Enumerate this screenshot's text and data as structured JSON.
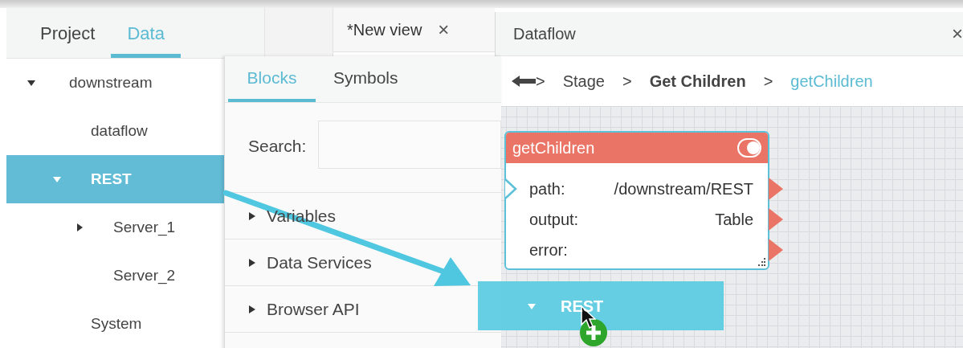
{
  "left_panel": {
    "tabs": [
      {
        "label": "Project",
        "selected": false
      },
      {
        "label": "Data",
        "selected": true
      }
    ],
    "tree": [
      {
        "label": "downstream",
        "kind": "branch",
        "expanded": true,
        "selected": false,
        "children": [
          {
            "label": "dataflow",
            "kind": "leaf",
            "selected": false
          },
          {
            "label": "REST",
            "kind": "branch",
            "expanded": true,
            "selected": true,
            "children": [
              {
                "label": "Server_1",
                "kind": "branch",
                "expanded": false,
                "selected": false
              },
              {
                "label": "Server_2",
                "kind": "leaf",
                "selected": false
              }
            ]
          },
          {
            "label": "System",
            "kind": "leaf",
            "selected": false
          }
        ]
      }
    ]
  },
  "editor_tab": {
    "label": "*New view",
    "close": "×"
  },
  "blocks_panel": {
    "tabs": [
      {
        "label": "Blocks",
        "selected": true
      },
      {
        "label": "Symbols",
        "selected": false
      }
    ],
    "search": {
      "label": "Search:"
    },
    "categories": [
      {
        "label": "Variables"
      },
      {
        "label": "Data Services"
      },
      {
        "label": "Browser API"
      }
    ]
  },
  "dataflow": {
    "title": "Dataflow",
    "close": "×",
    "breadcrumb": [
      {
        "separator": ">",
        "label": "Stage",
        "kind": "normal"
      },
      {
        "separator": ">",
        "label": "Get Children",
        "kind": "bold"
      },
      {
        "separator": ">",
        "label": "getChildren",
        "kind": "current"
      }
    ],
    "node": {
      "title": "getChildren",
      "toggle_on": true,
      "fields": [
        {
          "name": "path:",
          "value": "/downstream/REST",
          "kind": "input"
        },
        {
          "name": "output:",
          "value": "Table",
          "kind": "output"
        },
        {
          "name": "error:",
          "kind": "output"
        }
      ]
    }
  },
  "drag_ghost": {
    "label": "REST",
    "expanded": true
  }
}
